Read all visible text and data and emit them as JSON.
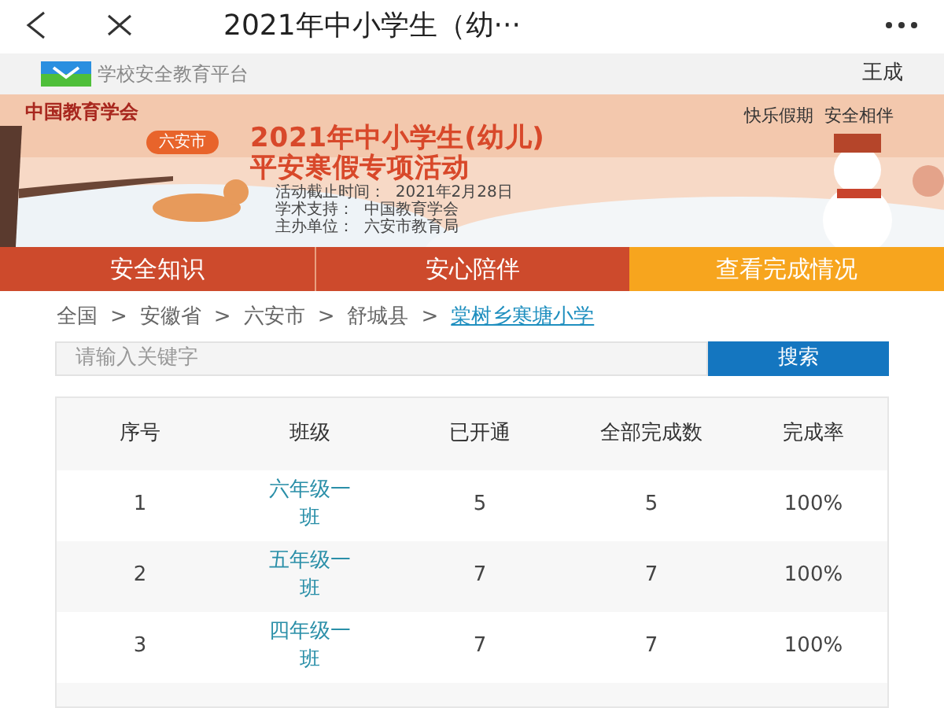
{
  "nav_bar": {
    "title": "2021年中小学生（幼···"
  },
  "site_bar": {
    "site_name": "学校安全教育平台",
    "user": "王成"
  },
  "banner": {
    "logo_text": "中国教育学会",
    "motto": "快乐假期  安全相伴",
    "city": "六安市",
    "title_lines": [
      "2021年中小学生(幼儿)",
      "平安寒假专项活动"
    ],
    "info_lines": [
      "活动截止时间：  2021年2月28日",
      "学术支持：  中国教育学会",
      "主办单位：  六安市教育局"
    ]
  },
  "tabs": [
    {
      "label": "安全知识",
      "selected": false
    },
    {
      "label": "安心陪伴",
      "selected": false
    },
    {
      "label": "查看完成情况",
      "selected": true
    }
  ],
  "breadcrumb": {
    "items": [
      "全国",
      "安徽省",
      "六安市",
      "舒城县"
    ],
    "separator": ">",
    "current": "棠树乡寒塘小学"
  },
  "search": {
    "placeholder": "请输入关键字",
    "button": "搜索"
  },
  "table": {
    "columns": [
      "序号",
      "班级",
      "已开通",
      "全部完成数",
      "完成率"
    ],
    "rows": [
      [
        "1",
        "六年级一班",
        "5",
        "5",
        "100%"
      ],
      [
        "2",
        "五年级一班",
        "7",
        "7",
        "100%"
      ],
      [
        "3",
        "四年级一班",
        "7",
        "7",
        "100%"
      ]
    ]
  }
}
